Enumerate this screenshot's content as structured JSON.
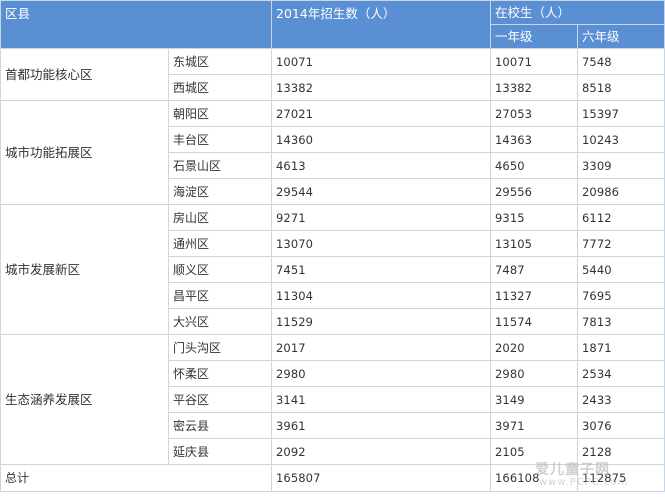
{
  "headers": {
    "district": "区县",
    "enroll_2014": "2014年招生数（人）",
    "in_school": "在校生（人）",
    "grade1": "一年级",
    "grade6": "六年级"
  },
  "groups": [
    {
      "name": "首都功能核心区",
      "rows": [
        {
          "district": "东城区",
          "enroll": "10071",
          "g1": "10071",
          "g6": "7548"
        },
        {
          "district": "西城区",
          "enroll": "13382",
          "g1": "13382",
          "g6": "8518"
        }
      ]
    },
    {
      "name": "城市功能拓展区",
      "rows": [
        {
          "district": "朝阳区",
          "enroll": "27021",
          "g1": "27053",
          "g6": "15397"
        },
        {
          "district": "丰台区",
          "enroll": "14360",
          "g1": "14363",
          "g6": "10243"
        },
        {
          "district": "石景山区",
          "enroll": "4613",
          "g1": "4650",
          "g6": "3309"
        },
        {
          "district": "海淀区",
          "enroll": "29544",
          "g1": "29556",
          "g6": "20986"
        }
      ]
    },
    {
      "name": "城市发展新区",
      "rows": [
        {
          "district": "房山区",
          "enroll": "9271",
          "g1": "9315",
          "g6": "6112"
        },
        {
          "district": "通州区",
          "enroll": "13070",
          "g1": "13105",
          "g6": "7772"
        },
        {
          "district": "顺义区",
          "enroll": "7451",
          "g1": "7487",
          "g6": "5440"
        },
        {
          "district": "昌平区",
          "enroll": "11304",
          "g1": "11327",
          "g6": "7695"
        },
        {
          "district": "大兴区",
          "enroll": "11529",
          "g1": "11574",
          "g6": "7813"
        }
      ]
    },
    {
      "name": "生态涵养发展区",
      "rows": [
        {
          "district": "门头沟区",
          "enroll": "2017",
          "g1": "2020",
          "g6": "1871"
        },
        {
          "district": "怀柔区",
          "enroll": "2980",
          "g1": "2980",
          "g6": "2534"
        },
        {
          "district": "平谷区",
          "enroll": "3141",
          "g1": "3149",
          "g6": "2433"
        },
        {
          "district": "密云县",
          "enroll": "3961",
          "g1": "3971",
          "g6": "3076"
        },
        {
          "district": "延庆县",
          "enroll": "2092",
          "g1": "2105",
          "g6": "2128"
        }
      ]
    }
  ],
  "total": {
    "label": "总计",
    "enroll": "165807",
    "g1": "166108",
    "g6": "112875"
  },
  "watermark": {
    "main": "爱儿童子网",
    "sub": "www.PCPC.com"
  }
}
